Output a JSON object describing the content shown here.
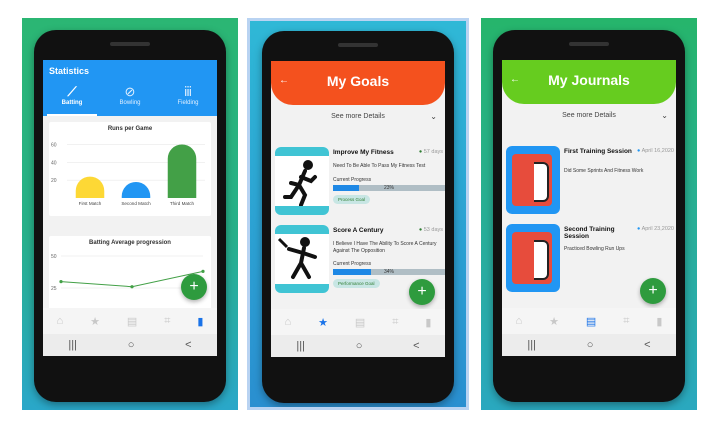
{
  "colors": {
    "stats_header": "#2196f3",
    "goals_header": "#f4511e",
    "journals_header": "#66cc1f",
    "fab": "#2e9b3e",
    "progress": "#1e88e5"
  },
  "statistics": {
    "title": "Statistics",
    "tabs": [
      {
        "label": "Batting",
        "icon": "cricket-bat-icon",
        "active": true
      },
      {
        "label": "Bowling",
        "icon": "ball-icon",
        "active": false
      },
      {
        "label": "Fielding",
        "icon": "stumps-icon",
        "active": false
      }
    ],
    "runs_chart": {
      "title": "Runs per Game",
      "y_ticks": [
        "60",
        "40",
        "20"
      ]
    },
    "avg_chart": {
      "title": "Batting Average progression",
      "y_ticks": [
        "50",
        "25",
        "0"
      ],
      "x_ticks": [
        "0",
        "1"
      ]
    },
    "fab_label": "+"
  },
  "chart_data": [
    {
      "type": "bar",
      "title": "Runs per Game",
      "categories": [
        "First Match",
        "Second Match",
        "Third Match"
      ],
      "values": [
        24,
        18,
        60
      ],
      "ylim": [
        0,
        65
      ],
      "colors": [
        "#fdd835",
        "#2196f3",
        "#43a047"
      ]
    },
    {
      "type": "line",
      "title": "Batting Average progression",
      "x": [
        0,
        1,
        2
      ],
      "values": [
        30,
        26,
        38
      ],
      "ylim": [
        0,
        50
      ]
    }
  ],
  "goals": {
    "title": "My Goals",
    "see_more": "See more Details",
    "items": [
      {
        "title": "Improve My Fitness",
        "date": "57 days",
        "description": "Need To Be Able To Pass My Fitness Test",
        "progress_label": "Current Progress",
        "progress": 0.23,
        "progress_text": "23%",
        "tag": "Process Goal"
      },
      {
        "title": "Score A Century",
        "date": "53 days",
        "description": "I Believe I Have The Ability To Score A Century Against The Opposition",
        "progress_label": "Current Progress",
        "progress": 0.34,
        "progress_text": "34%",
        "tag": "Performance Goal"
      }
    ]
  },
  "journals": {
    "title": "My Journals",
    "see_more": "See more Details",
    "items": [
      {
        "title": "First Training Session",
        "date": "April 16,2020",
        "description": "Did Some Sprints And Fitness Work"
      },
      {
        "title": "Second Training Session",
        "date": "April 23,2020",
        "description": "Practiced Bowling Run Ups"
      }
    ]
  },
  "bottom_nav_icons": [
    "home-icon",
    "star-icon",
    "journal-icon",
    "graduation-icon",
    "chart-icon"
  ],
  "system_nav": {
    "recent": "|||",
    "home": "○",
    "back": "<"
  }
}
